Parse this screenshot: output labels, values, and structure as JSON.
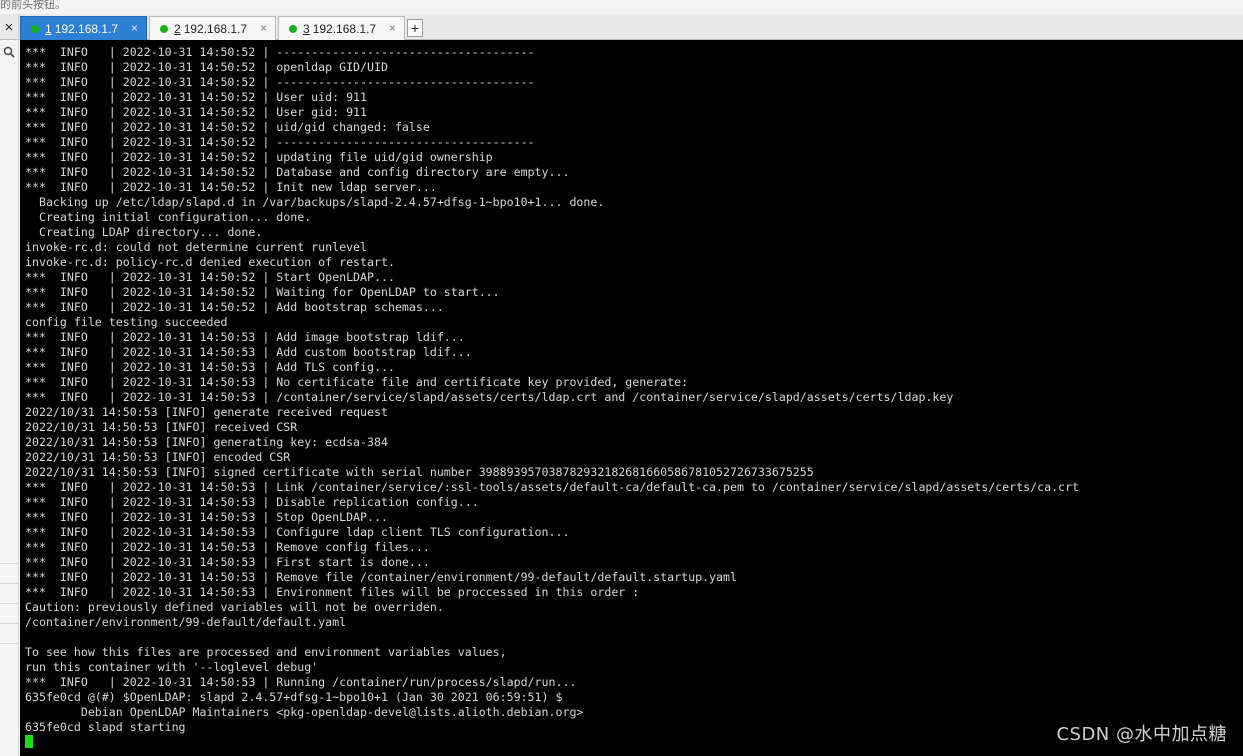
{
  "window": {
    "caption_fragment": "的前头按钮。"
  },
  "tabs": [
    {
      "number": "1",
      "title": "192.168.1.7",
      "active": true
    },
    {
      "number": "2",
      "title": "192.168.1.7",
      "active": false
    },
    {
      "number": "3",
      "title": "192.168.1.7",
      "active": false
    }
  ],
  "controls": {
    "close_all": "×",
    "new_tab": "+"
  },
  "terminal": {
    "lines": [
      "***  INFO   | 2022-10-31 14:50:52 | -------------------------------------",
      "***  INFO   | 2022-10-31 14:50:52 | openldap GID/UID",
      "***  INFO   | 2022-10-31 14:50:52 | -------------------------------------",
      "***  INFO   | 2022-10-31 14:50:52 | User uid: 911",
      "***  INFO   | 2022-10-31 14:50:52 | User gid: 911",
      "***  INFO   | 2022-10-31 14:50:52 | uid/gid changed: false",
      "***  INFO   | 2022-10-31 14:50:52 | -------------------------------------",
      "***  INFO   | 2022-10-31 14:50:52 | updating file uid/gid ownership",
      "***  INFO   | 2022-10-31 14:50:52 | Database and config directory are empty...",
      "***  INFO   | 2022-10-31 14:50:52 | Init new ldap server...",
      "  Backing up /etc/ldap/slapd.d in /var/backups/slapd-2.4.57+dfsg-1~bpo10+1... done.",
      "  Creating initial configuration... done.",
      "  Creating LDAP directory... done.",
      "invoke-rc.d: could not determine current runlevel",
      "invoke-rc.d: policy-rc.d denied execution of restart.",
      "***  INFO   | 2022-10-31 14:50:52 | Start OpenLDAP...",
      "***  INFO   | 2022-10-31 14:50:52 | Waiting for OpenLDAP to start...",
      "***  INFO   | 2022-10-31 14:50:52 | Add bootstrap schemas...",
      "config file testing succeeded",
      "***  INFO   | 2022-10-31 14:50:53 | Add image bootstrap ldif...",
      "***  INFO   | 2022-10-31 14:50:53 | Add custom bootstrap ldif...",
      "***  INFO   | 2022-10-31 14:50:53 | Add TLS config...",
      "***  INFO   | 2022-10-31 14:50:53 | No certificate file and certificate key provided, generate:",
      "***  INFO   | 2022-10-31 14:50:53 | /container/service/slapd/assets/certs/ldap.crt and /container/service/slapd/assets/certs/ldap.key",
      "2022/10/31 14:50:53 [INFO] generate received request",
      "2022/10/31 14:50:53 [INFO] received CSR",
      "2022/10/31 14:50:53 [INFO] generating key: ecdsa-384",
      "2022/10/31 14:50:53 [INFO] encoded CSR",
      "2022/10/31 14:50:53 [INFO] signed certificate with serial number 398893957038782932182681660586781052726733675255",
      "***  INFO   | 2022-10-31 14:50:53 | Link /container/service/:ssl-tools/assets/default-ca/default-ca.pem to /container/service/slapd/assets/certs/ca.crt",
      "***  INFO   | 2022-10-31 14:50:53 | Disable replication config...",
      "***  INFO   | 2022-10-31 14:50:53 | Stop OpenLDAP...",
      "***  INFO   | 2022-10-31 14:50:53 | Configure ldap client TLS configuration...",
      "***  INFO   | 2022-10-31 14:50:53 | Remove config files...",
      "***  INFO   | 2022-10-31 14:50:53 | First start is done...",
      "***  INFO   | 2022-10-31 14:50:53 | Remove file /container/environment/99-default/default.startup.yaml",
      "***  INFO   | 2022-10-31 14:50:53 | Environment files will be proccessed in this order :",
      "Caution: previously defined variables will not be overriden.",
      "/container/environment/99-default/default.yaml",
      "",
      "To see how this files are processed and environment variables values,",
      "run this container with '--loglevel debug'",
      "***  INFO   | 2022-10-31 14:50:53 | Running /container/run/process/slapd/run...",
      "635fe0cd @(#) $OpenLDAP: slapd 2.4.57+dfsg-1~bpo10+1 (Jan 30 2021 06:59:51) $",
      "        Debian OpenLDAP Maintainers <pkg-openldap-devel@lists.alioth.debian.org>",
      "635fe0cd slapd starting"
    ]
  },
  "watermark": "CSDN @水中加点糖",
  "colors": {
    "terminal_bg": "#000000",
    "terminal_fg": "#d8d8d8",
    "cursor": "#18e018",
    "active_tab": "#2e7fd6",
    "status_dot": "#17b317"
  }
}
